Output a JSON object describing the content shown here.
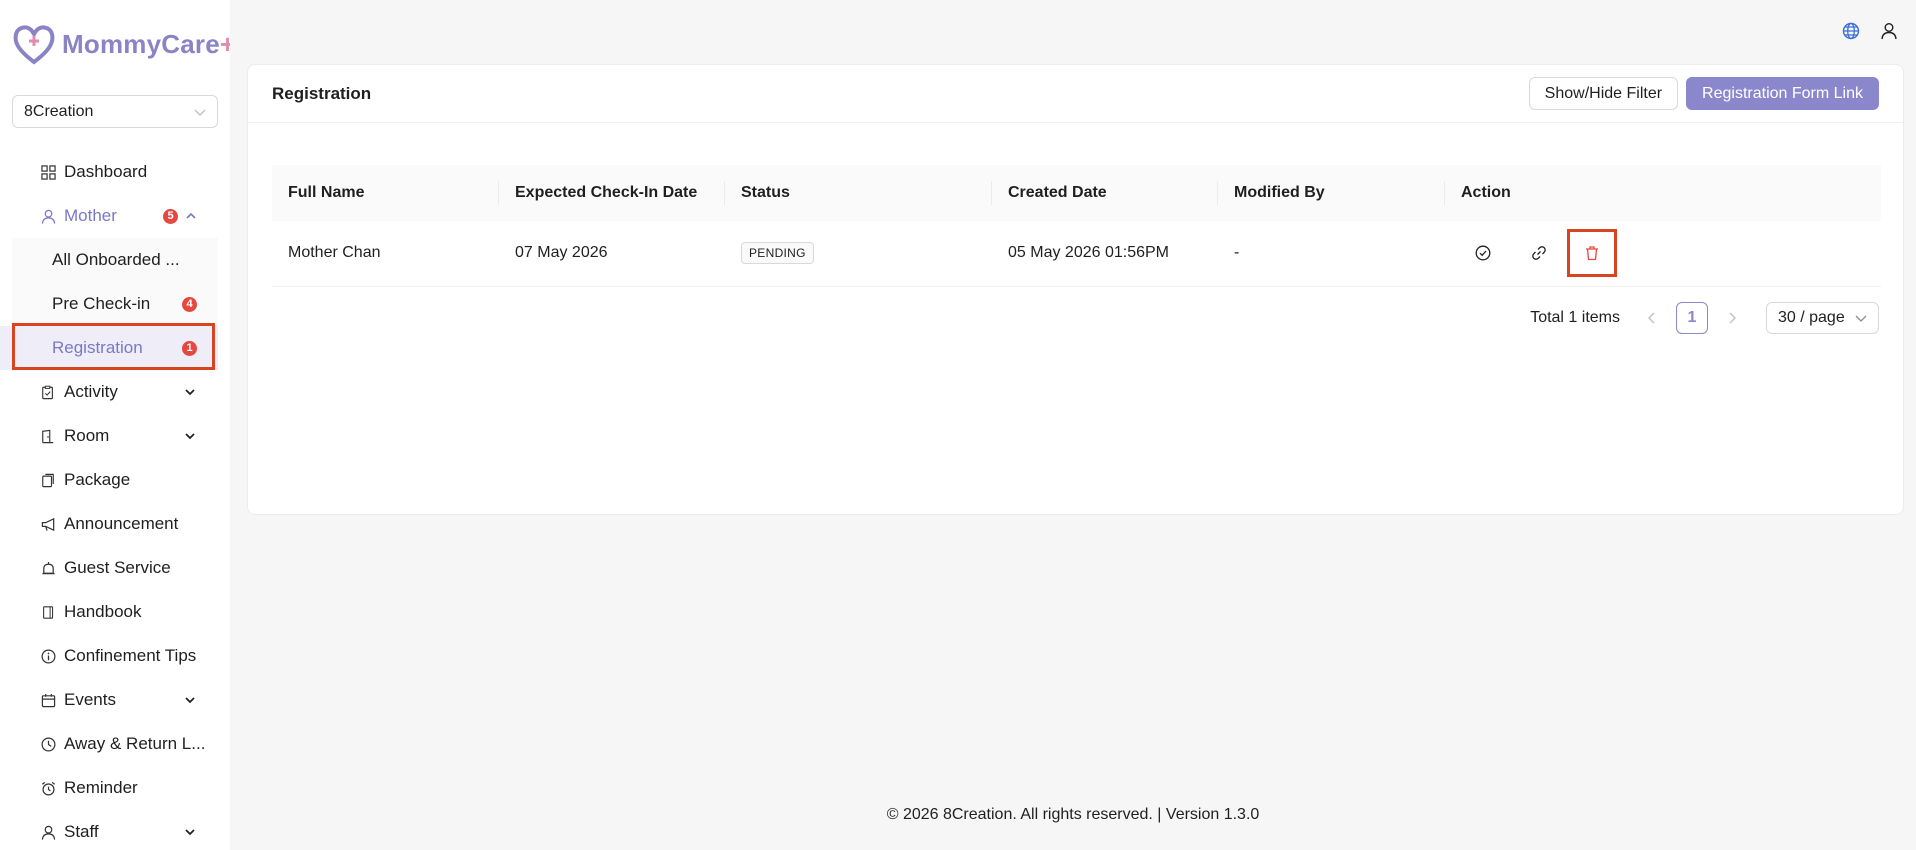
{
  "app": {
    "name": "MommyCare",
    "name_suffix": "+"
  },
  "org_select": {
    "value": "8Creation"
  },
  "sidebar": {
    "items": [
      {
        "label": "Dashboard",
        "icon": "dashboard-icon"
      },
      {
        "label": "Mother",
        "icon": "user-icon",
        "badge": "5",
        "expanded": true,
        "children": [
          {
            "label": "All Onboarded ..."
          },
          {
            "label": "Pre Check-in",
            "badge": "4"
          },
          {
            "label": "Registration",
            "badge": "1",
            "selected": true
          }
        ]
      },
      {
        "label": "Activity",
        "icon": "clipboard-icon",
        "has_children": true
      },
      {
        "label": "Room",
        "icon": "room-icon",
        "has_children": true
      },
      {
        "label": "Package",
        "icon": "package-icon"
      },
      {
        "label": "Announcement",
        "icon": "megaphone-icon"
      },
      {
        "label": "Guest Service",
        "icon": "bell-icon"
      },
      {
        "label": "Handbook",
        "icon": "book-icon"
      },
      {
        "label": "Confinement Tips",
        "icon": "info-icon"
      },
      {
        "label": "Events",
        "icon": "calendar-icon",
        "has_children": true
      },
      {
        "label": "Away & Return L...",
        "icon": "clock-icon"
      },
      {
        "label": "Reminder",
        "icon": "alarm-icon"
      },
      {
        "label": "Staff",
        "icon": "staff-icon",
        "has_children": true
      }
    ]
  },
  "page": {
    "title": "Registration",
    "buttons": {
      "filter": "Show/Hide Filter",
      "form_link": "Registration Form Link"
    }
  },
  "table": {
    "columns": [
      "Full Name",
      "Expected Check-In Date",
      "Status",
      "Created Date",
      "Modified By",
      "Action"
    ],
    "rows": [
      {
        "full_name": "Mother Chan",
        "check_in": "07 May 2026",
        "status": "PENDING",
        "created": "05 May 2026 01:56PM",
        "modified_by": "-"
      }
    ]
  },
  "pagination": {
    "total": "Total 1 items",
    "current": "1",
    "page_size": "30 / page"
  },
  "footer": {
    "text": "© 2026 8Creation. All rights reserved. | Version 1.3.0"
  },
  "colors": {
    "accent": "#8b87cc",
    "badge": "#e5483f",
    "highlight": "#d9431f"
  }
}
